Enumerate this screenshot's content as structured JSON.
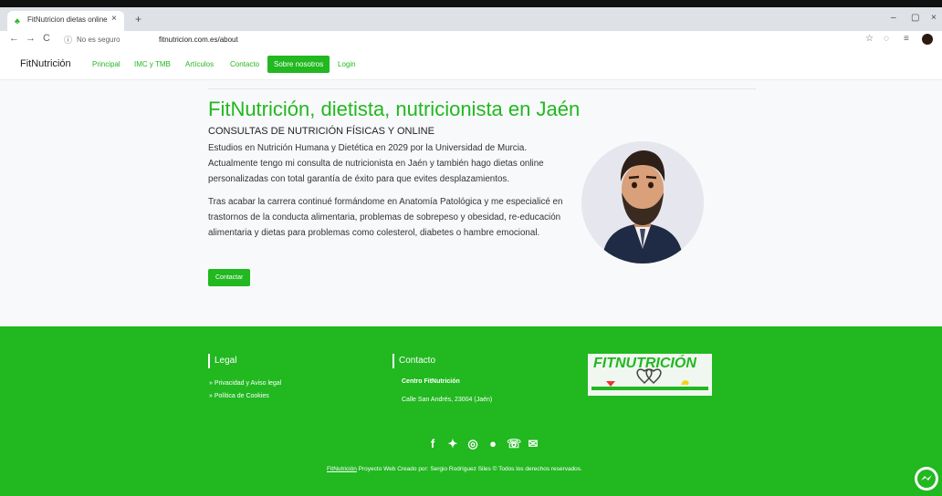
{
  "browser": {
    "tab_title": "FitNutricion dietas online",
    "tab_close": "×",
    "new_tab": "+",
    "not_secure": "No es seguro",
    "url": "fitnutricion.com.es/about",
    "back": "←",
    "forward": "→",
    "reload": "C"
  },
  "nav": {
    "brand": "FitNutrición",
    "links": [
      "Principal",
      "IMC y TMB",
      "Artículos",
      "Contacto",
      "Sobre nosotros",
      "Login"
    ],
    "active_index": 4
  },
  "hero": {
    "title": "FitNutrición, dietista, nutricionista en Jaén",
    "subtitle": "CONSULTAS DE NUTRICIÓN FÍSICAS Y ONLINE",
    "paragraph1": "Estudios en Nutrición Humana y Dietética en 2029 por la Universidad de Murcia. Actualmente tengo mi consulta de nutricionista en Jaén y también hago dietas online personalizadas con total garantía de éxito para que evites desplazamientos.",
    "paragraph2": "Tras acabar la carrera continué formándome en Anatomía Patológica y me especialicé en trastornos de la conducta alimentaria, problemas de sobrepeso y obesidad, re-educación alimentaria y dietas para problemas como colesterol, diabetes o hambre emocional.",
    "cta": "Contactar"
  },
  "footer": {
    "legal_title": "Legal",
    "legal_links": [
      "» Privacidad y Aviso legal",
      "» Política de Cookies"
    ],
    "contact_title": "Contacto",
    "contact_name": "Centro FitNutrición",
    "contact_address": "Calle San Andrés, 23004 (Jaén)",
    "logo_text": "FITNUTRICIÓN",
    "copyright_link": "FitNutrición",
    "copyright_rest": " Proyecto Web Creado por: Sergio Rodríguez Siles © Todos los derechos reservados."
  },
  "colors": {
    "brand_green": "#21b820",
    "bg_main": "#f8f9fa"
  }
}
